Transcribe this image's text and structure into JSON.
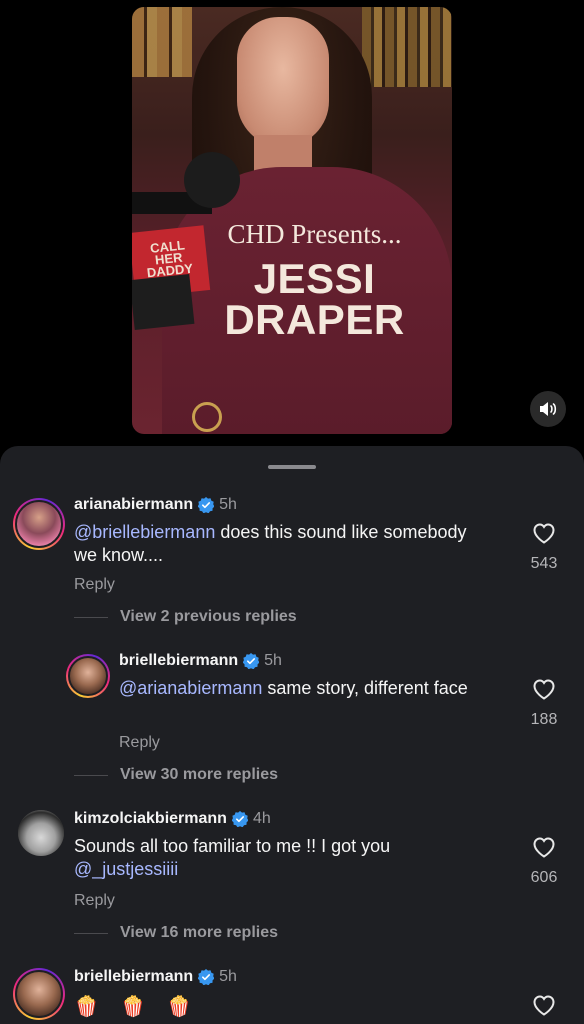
{
  "video": {
    "overlay_presents": "CHD Presents...",
    "overlay_name_line1": "JESSI",
    "overlay_name_line2": "DRAPER",
    "mic_flag_text": "CALL HER DADDY",
    "mute_icon": "speaker-icon"
  },
  "comments": [
    {
      "username": "arianabiermann",
      "verified": true,
      "time": "5h",
      "mention": "@briellebiermann",
      "text": " does this sound like somebody we know....",
      "reply_label": "Reply",
      "likes": "543"
    },
    {
      "view_replies": "View 2 previous replies"
    },
    {
      "username": "briellebiermann",
      "verified": true,
      "time": "5h",
      "mention": "@arianabiermann",
      "text": " same story, different face",
      "reply_label": "Reply",
      "likes": "188"
    },
    {
      "view_replies": "View 30 more replies"
    },
    {
      "username": "kimzolciakbiermann",
      "verified": true,
      "time": "4h",
      "text": "Sounds all too familiar to me !! I got you ",
      "mention": "@_justjessiiii",
      "reply_label": "Reply",
      "likes": "606"
    },
    {
      "view_replies": "View 16 more replies"
    },
    {
      "username": "briellebiermann",
      "verified": true,
      "time": "5h",
      "text": "🍿 🍿 🍿"
    }
  ],
  "colors": {
    "sheet_bg": "#1e1f23",
    "mention": "#a8b8ff",
    "verified": "#3897f0"
  }
}
